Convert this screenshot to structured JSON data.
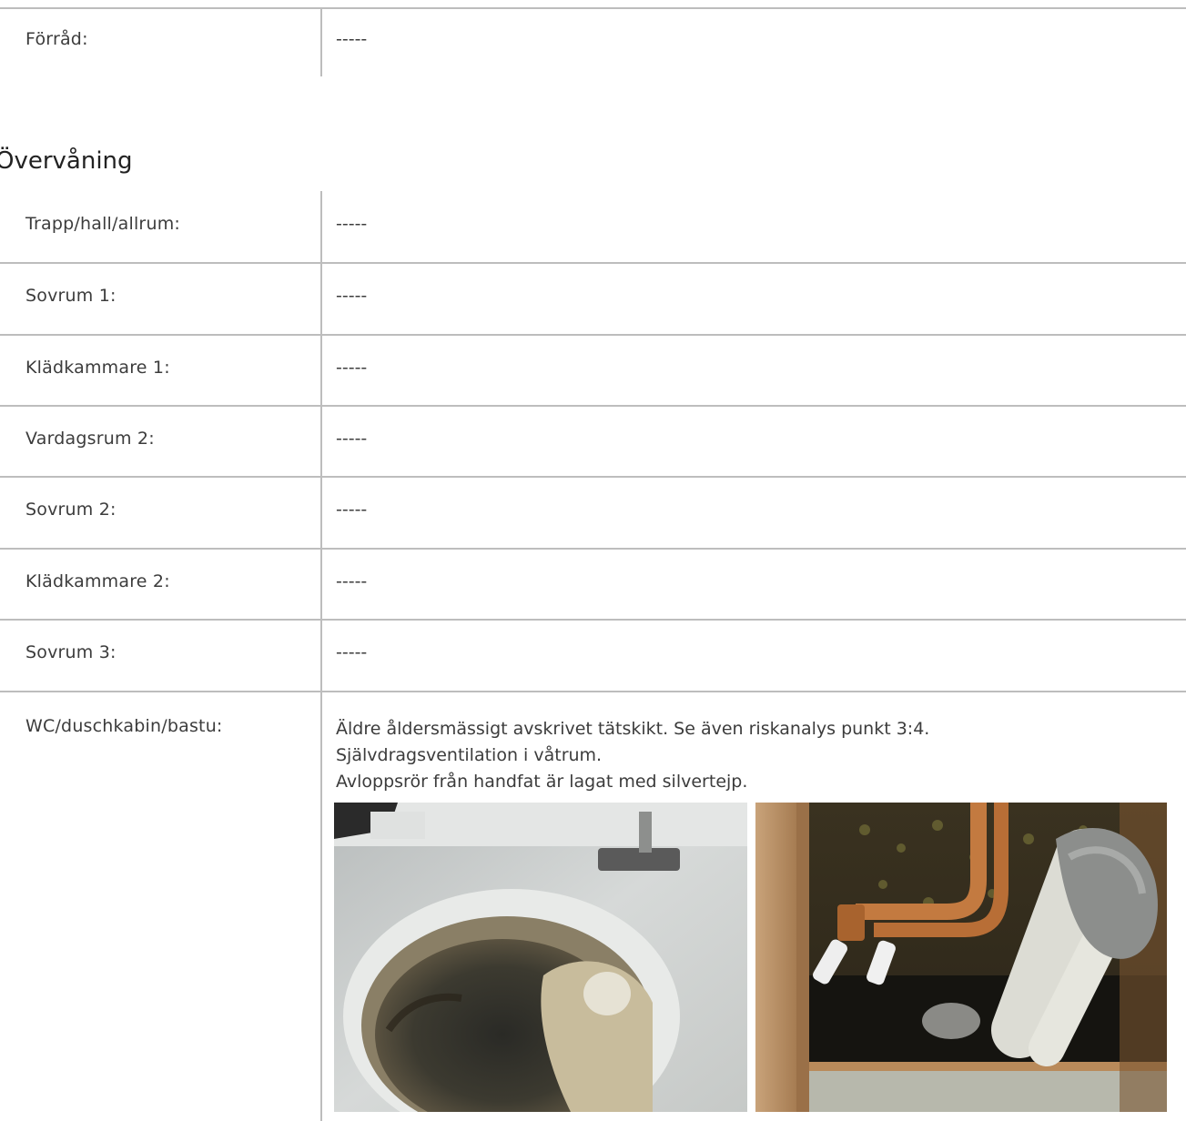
{
  "first_table": {
    "rows": [
      {
        "label": "Förråd:",
        "value": "-----"
      }
    ]
  },
  "section": {
    "heading": "Övervåning"
  },
  "second_table": {
    "rows": [
      {
        "label": "Trapp/hall/allrum:",
        "value": "-----"
      },
      {
        "label": "Sovrum 1:",
        "value": "-----"
      },
      {
        "label": "Klädkammare 1:",
        "value": "-----"
      },
      {
        "label": "Vardagsrum 2:",
        "value": "-----"
      },
      {
        "label": "Sovrum 2:",
        "value": "-----"
      },
      {
        "label": "Klädkammare 2:",
        "value": "-----"
      },
      {
        "label": "Sovrum 3:",
        "value": "-----"
      }
    ],
    "wc_row": {
      "label": "WC/duschkabin/bastu:",
      "lines": [
        "Äldre åldersmässigt avskrivet tätskikt. Se även riskanalys punkt 3:4.",
        "Självdragsventilation i våtrum.",
        "Avloppsrör från handfat är lagat med silvertejp."
      ]
    }
  }
}
